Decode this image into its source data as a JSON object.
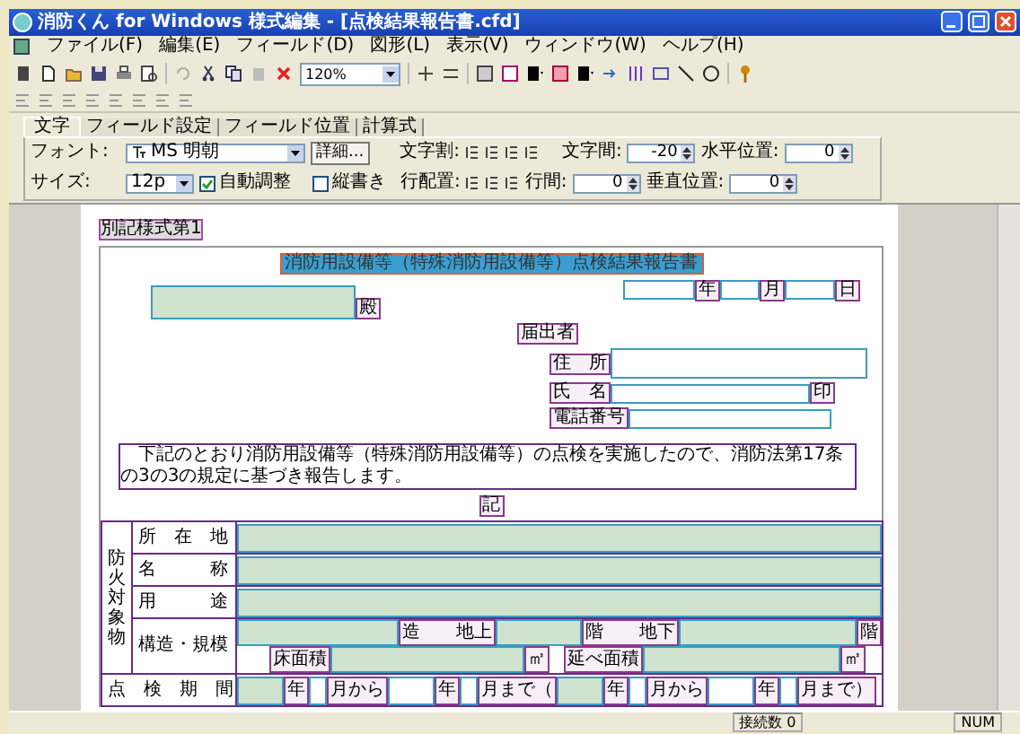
{
  "window": {
    "title": "消防くん for Windows 様式編集 - [点検結果報告書.cfd]"
  },
  "menu": [
    "ファイル(F)",
    "編集(E)",
    "フィールド(D)",
    "図形(L)",
    "表示(V)",
    "ウィンドウ(W)",
    "ヘルプ(H)"
  ],
  "toolbar": {
    "zoom": "120%"
  },
  "property_tabs": [
    {
      "label": "文字",
      "selected": true
    },
    {
      "label": "フィールド設定",
      "selected": false
    },
    {
      "label": "フィールド位置",
      "selected": false
    },
    {
      "label": "計算式",
      "selected": false
    }
  ],
  "properties": {
    "font_label": "フォント:",
    "font": "MS 明朝",
    "detail_button": "詳細...",
    "size_label": "サイズ:",
    "size": "12p",
    "auto_fit": {
      "label": "自動調整",
      "checked": true
    },
    "vertical": {
      "label": "縦書き",
      "checked": false
    },
    "char_align_label": "文字割:",
    "line_align_label": "行配置:",
    "char_spacing": {
      "label": "文字間:",
      "value": "-20"
    },
    "line_spacing": {
      "label": "行間:",
      "value": "0"
    },
    "h_pos": {
      "label": "水平位置:",
      "value": "0"
    },
    "v_pos": {
      "label": "垂直位置:",
      "value": "0"
    }
  },
  "form": {
    "form_number": "別記様式第1",
    "title": "消防用設備等（特殊消防用設備等）点検結果報告書",
    "date_labels": [
      "年",
      "月",
      "日"
    ],
    "addressee_suffix": "殿",
    "applicant_label": "届出者",
    "address_label": "住　所",
    "name_label": "氏　名",
    "seal": "印",
    "phone_label": "電話番号",
    "statement": "下記のとおり消防用設備等（特殊消防用設備等）の点検を実施したので、消防法第17条の3の3の規定に基づき報告します。",
    "record_label": "記",
    "table": {
      "side_label": "防火対象物",
      "rows": [
        {
          "kind": "field",
          "label": "所　在　地"
        },
        {
          "kind": "field",
          "label": "名　　　称"
        },
        {
          "kind": "field",
          "label": "用　　　途"
        },
        {
          "kind": "structure",
          "label": "構造・規模",
          "line1": [
            "造　　地上",
            "階　　地下",
            "階"
          ],
          "line2": [
            "床面積",
            "㎡",
            "延べ面積",
            "㎡"
          ]
        },
        {
          "kind": "period",
          "label": "点　検　期　間",
          "parts": [
            "年",
            "月から",
            "年",
            "月まで（",
            "年",
            "月から",
            "年",
            "月まで）"
          ]
        }
      ]
    }
  },
  "status_bar": {
    "connections": "接続数 0",
    "num": "NUM"
  }
}
